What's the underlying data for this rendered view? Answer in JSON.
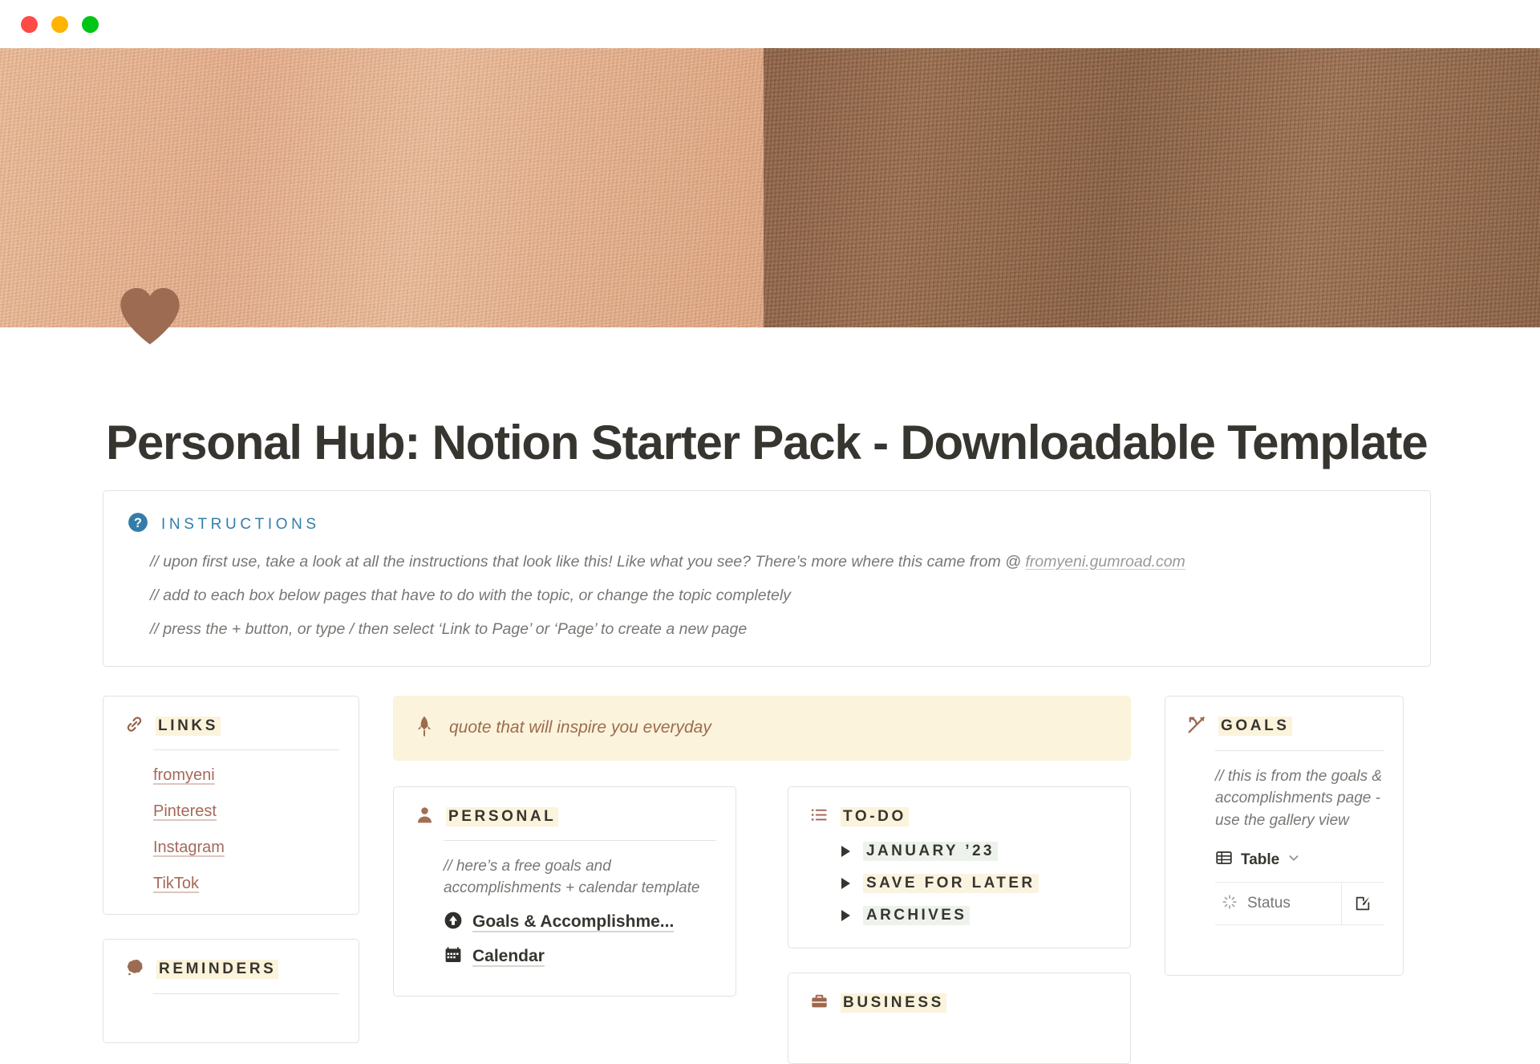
{
  "window": {
    "traffic_lights": [
      "close-red",
      "minimize-yellow",
      "maximize-green"
    ],
    "colors": {
      "red": "#FF4B45",
      "yellow": "#FFB400",
      "green": "#00C514"
    }
  },
  "cover": {
    "icon": "brown-heart",
    "icon_color": "#9C6B51",
    "left_color": "#E5B08C",
    "right_color": "#8F6749"
  },
  "page": {
    "title": "Personal Hub: Notion Starter Pack - Downloadable Template"
  },
  "instructions": {
    "icon": "question-mark-circle-icon",
    "icon_color": "#337EA9",
    "title": "INSTRUCTIONS",
    "lines": [
      {
        "before": "// upon first use, take a look at all the instructions that look like this! Like what you see? There’s more where this came from @ ",
        "link": "fromyeni.gumroad.com"
      },
      {
        "before": "// add to each box below pages that have to do with the topic, or change the topic completely",
        "link": ""
      },
      {
        "before": "// press the + button, or type / then select ‘Link to Page’ or ‘Page’ to create a new page",
        "link": ""
      }
    ]
  },
  "links_card": {
    "icon": "link-chain-icon",
    "title": "LINKS",
    "items": [
      {
        "label": "fromyeni"
      },
      {
        "label": "Pinterest"
      },
      {
        "label": "Instagram"
      },
      {
        "label": "TikTok"
      }
    ]
  },
  "reminders_card": {
    "icon": "brown-blob-icon",
    "title": "REMINDERS"
  },
  "quote_banner": {
    "icon": "rocket-icon",
    "text": "quote that will inspire you everyday",
    "background": "#FBF3DB",
    "text_color": "#9B6C4E"
  },
  "personal_card": {
    "icon": "person-icon",
    "title": "PERSONAL",
    "note": "// here’s a free goals and accomplishments + calendar template",
    "page_links": [
      {
        "icon": "up-arrow-circle-icon",
        "label": "Goals & Accomplishme..."
      },
      {
        "icon": "calendar-icon",
        "label": "Calendar"
      }
    ]
  },
  "todo_card": {
    "icon": "bulleted-list-icon",
    "title": "TO-DO",
    "toggles": [
      {
        "label": "JANUARY ’23",
        "highlight": "#EDF3EC"
      },
      {
        "label": "SAVE FOR LATER",
        "highlight": "#FAF3E0"
      },
      {
        "label": "ARCHIVES",
        "highlight": "#EDF3EC"
      }
    ]
  },
  "business_card": {
    "icon": "briefcase-icon",
    "title": "BUSINESS"
  },
  "goals_card": {
    "icon": "bow-and-arrow-icon",
    "title": "GOALS",
    "note": "// this is from the goals & accomplishments page - use the gallery view",
    "view": {
      "icon": "table-icon",
      "label": "Table",
      "chevron": "chevron-down-icon"
    },
    "table": {
      "columns": [
        {
          "icon": "status-spinner-icon",
          "label": "Status"
        }
      ],
      "action_icon": "open-page-icon"
    }
  }
}
